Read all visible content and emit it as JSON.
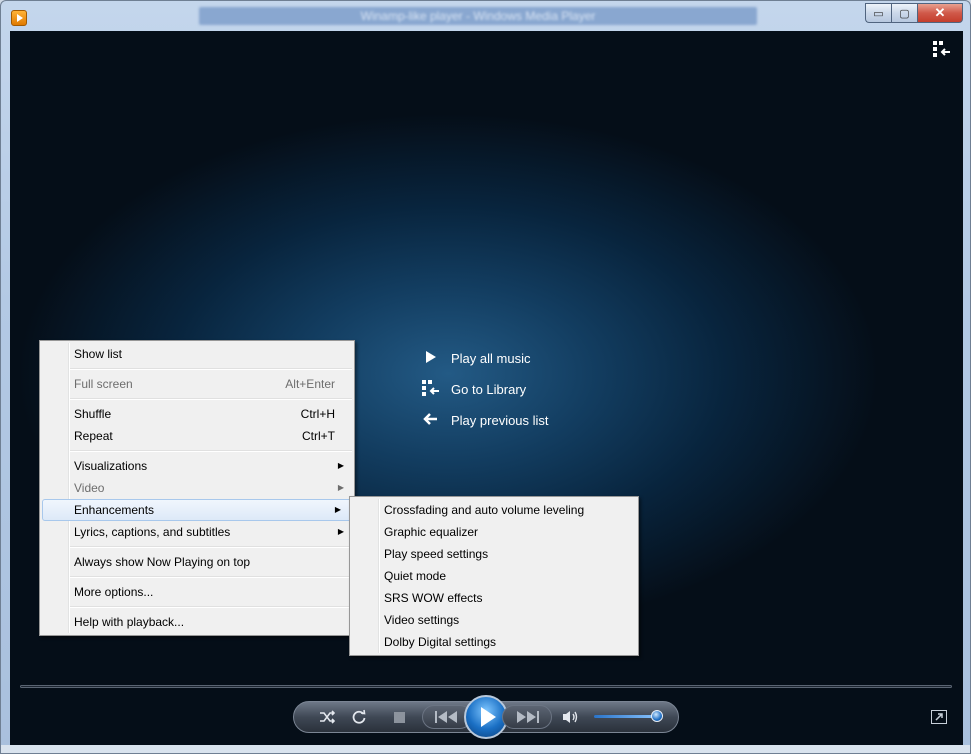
{
  "window": {
    "title": "Winamp-like player - Windows Media Player",
    "caption_buttons": {
      "minimize": "▭",
      "maximize": "▢",
      "close": "✕"
    }
  },
  "now_playing": {
    "actions": [
      {
        "label": "Play all music",
        "icon": "play-icon"
      },
      {
        "label": "Go to Library",
        "icon": "library-icon"
      },
      {
        "label": "Play previous list",
        "icon": "back-arrow-icon"
      }
    ]
  },
  "context_menu": {
    "show_list": "Show list",
    "full_screen": "Full screen",
    "full_screen_shortcut": "Alt+Enter",
    "shuffle": "Shuffle",
    "shuffle_shortcut": "Ctrl+H",
    "repeat": "Repeat",
    "repeat_shortcut": "Ctrl+T",
    "visualizations": "Visualizations",
    "video": "Video",
    "enhancements": "Enhancements",
    "lyrics": "Lyrics, captions, and subtitles",
    "always_on_top": "Always show Now Playing on top",
    "more_options": "More options...",
    "help": "Help with playback..."
  },
  "enhancements_submenu": {
    "items": [
      "Crossfading and auto volume leveling",
      "Graphic equalizer",
      "Play speed settings",
      "Quiet mode",
      "SRS WOW effects",
      "Video settings",
      "Dolby Digital settings"
    ]
  },
  "controls": {
    "volume_level": 0.93
  },
  "colors": {
    "menu_bg": "#f0f0f0",
    "highlight_border": "#a8c8ec",
    "viewport_center": "#235a85"
  }
}
